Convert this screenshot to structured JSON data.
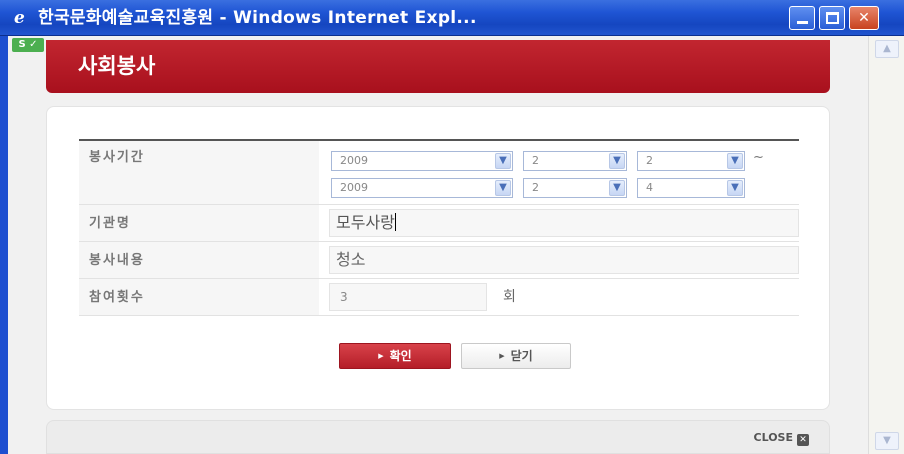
{
  "window": {
    "title": "한국문화예술교육진흥원 - Windows Internet Expl...",
    "logo_icon": "ie-logo-icon",
    "minimize_glyph": "",
    "maximize_glyph": "",
    "close_glyph": "✕"
  },
  "header": {
    "title": "사회봉사",
    "badge": "S ✓"
  },
  "form": {
    "period": {
      "label": "봉사기간",
      "start": {
        "year": "2009",
        "month": "2",
        "day": "2"
      },
      "separator": "~",
      "end": {
        "year": "2009",
        "month": "2",
        "day": "4"
      }
    },
    "institution": {
      "label": "기관명",
      "value": "모두사랑"
    },
    "content": {
      "label": "봉사내용",
      "value": "청소"
    },
    "count": {
      "label": "참여횟수",
      "value": "3",
      "unit": "회"
    }
  },
  "buttons": {
    "confirm": "확인",
    "close": "닫기",
    "bullet": "▶"
  },
  "footer": {
    "close_label": "CLOSE",
    "close_icon": "x-icon",
    "close_glyph": "✕"
  },
  "scroll": {
    "up": "▲",
    "down": "▼"
  },
  "colors": {
    "titlebar": "#1f55d4",
    "header_red": "#b01824",
    "confirm_button": "#c8303a"
  }
}
